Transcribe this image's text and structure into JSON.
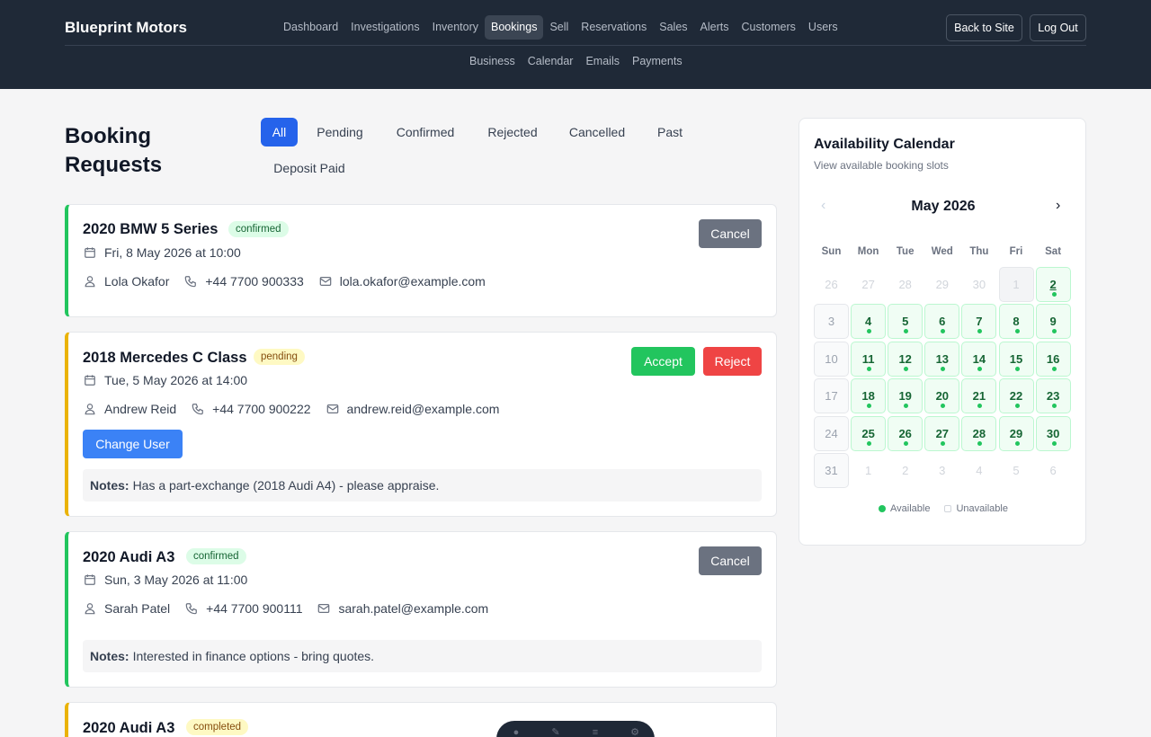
{
  "header": {
    "brand": "Blueprint Motors",
    "nav_primary": [
      "Dashboard",
      "Investigations",
      "Inventory",
      "Bookings",
      "Sell",
      "Reservations",
      "Sales",
      "Alerts",
      "Customers",
      "Users"
    ],
    "nav_active": "Bookings",
    "nav_secondary": [
      "Business",
      "Calendar",
      "Emails",
      "Payments"
    ],
    "back_label": "Back to Site",
    "logout_label": "Log Out"
  },
  "page": {
    "title": "Booking Requests",
    "filters": [
      "All",
      "Pending",
      "Confirmed",
      "Rejected",
      "Cancelled",
      "Past",
      "Deposit Paid"
    ],
    "active_filter": "All"
  },
  "bookings": [
    {
      "title": "2020 BMW 5 Series",
      "status": "confirmed",
      "datetime": "Fri, 8 May 2026 at 10:00",
      "name": "Lola Okafor",
      "phone": "+44 7700 900333",
      "email": "lola.okafor@example.com",
      "actions": [
        "Cancel"
      ]
    },
    {
      "title": "2018 Mercedes C Class",
      "status": "pending",
      "datetime": "Tue, 5 May 2026 at 14:00",
      "name": "Andrew Reid",
      "phone": "+44 7700 900222",
      "email": "andrew.reid@example.com",
      "actions": [
        "Accept",
        "Reject"
      ],
      "change_user_label": "Change User",
      "notes_label": "Notes:",
      "notes": "Has a part-exchange (2018 Audi A4) - please appraise."
    },
    {
      "title": "2020 Audi A3",
      "status": "confirmed",
      "datetime": "Sun, 3 May 2026 at 11:00",
      "name": "Sarah Patel",
      "phone": "+44 7700 900111",
      "email": "sarah.patel@example.com",
      "actions": [
        "Cancel"
      ],
      "notes_label": "Notes:",
      "notes": "Interested in finance options - bring quotes."
    },
    {
      "title": "2020 Audi A3",
      "status": "completed"
    }
  ],
  "calendar": {
    "title": "Availability Calendar",
    "subtitle": "View available booking slots",
    "month": "May 2026",
    "prev": "‹",
    "next": "›",
    "weekdays": [
      "Sun",
      "Mon",
      "Tue",
      "Wed",
      "Thu",
      "Fri",
      "Sat"
    ],
    "weeks": [
      [
        [
          "26",
          "blank"
        ],
        [
          "27",
          "blank"
        ],
        [
          "28",
          "blank"
        ],
        [
          "29",
          "blank"
        ],
        [
          "30",
          "blank"
        ],
        [
          "1",
          "today"
        ],
        [
          "2",
          "avail"
        ]
      ],
      [
        [
          "3",
          "un"
        ],
        [
          "4",
          "avail"
        ],
        [
          "5",
          "avail"
        ],
        [
          "6",
          "avail"
        ],
        [
          "7",
          "avail"
        ],
        [
          "8",
          "avail"
        ],
        [
          "9",
          "avail"
        ]
      ],
      [
        [
          "10",
          "un"
        ],
        [
          "11",
          "avail"
        ],
        [
          "12",
          "avail"
        ],
        [
          "13",
          "avail"
        ],
        [
          "14",
          "avail"
        ],
        [
          "15",
          "avail"
        ],
        [
          "16",
          "avail"
        ]
      ],
      [
        [
          "17",
          "un"
        ],
        [
          "18",
          "avail"
        ],
        [
          "19",
          "avail"
        ],
        [
          "20",
          "avail"
        ],
        [
          "21",
          "avail"
        ],
        [
          "22",
          "avail"
        ],
        [
          "23",
          "avail"
        ]
      ],
      [
        [
          "24",
          "un"
        ],
        [
          "25",
          "avail"
        ],
        [
          "26",
          "avail"
        ],
        [
          "27",
          "avail"
        ],
        [
          "28",
          "avail"
        ],
        [
          "29",
          "avail"
        ],
        [
          "30",
          "avail"
        ]
      ],
      [
        [
          "31",
          "un"
        ],
        [
          "1",
          "blank"
        ],
        [
          "2",
          "blank"
        ],
        [
          "3",
          "blank"
        ],
        [
          "4",
          "blank"
        ],
        [
          "5",
          "blank"
        ],
        [
          "6",
          "blank"
        ]
      ]
    ],
    "legend_available": "Available",
    "legend_unavailable": "Unavailable"
  },
  "colors": {
    "accent": "#2563eb",
    "confirmed": "#22c55e",
    "pending": "#eab308",
    "danger": "#ef4444",
    "header_bg": "#1f2937"
  }
}
